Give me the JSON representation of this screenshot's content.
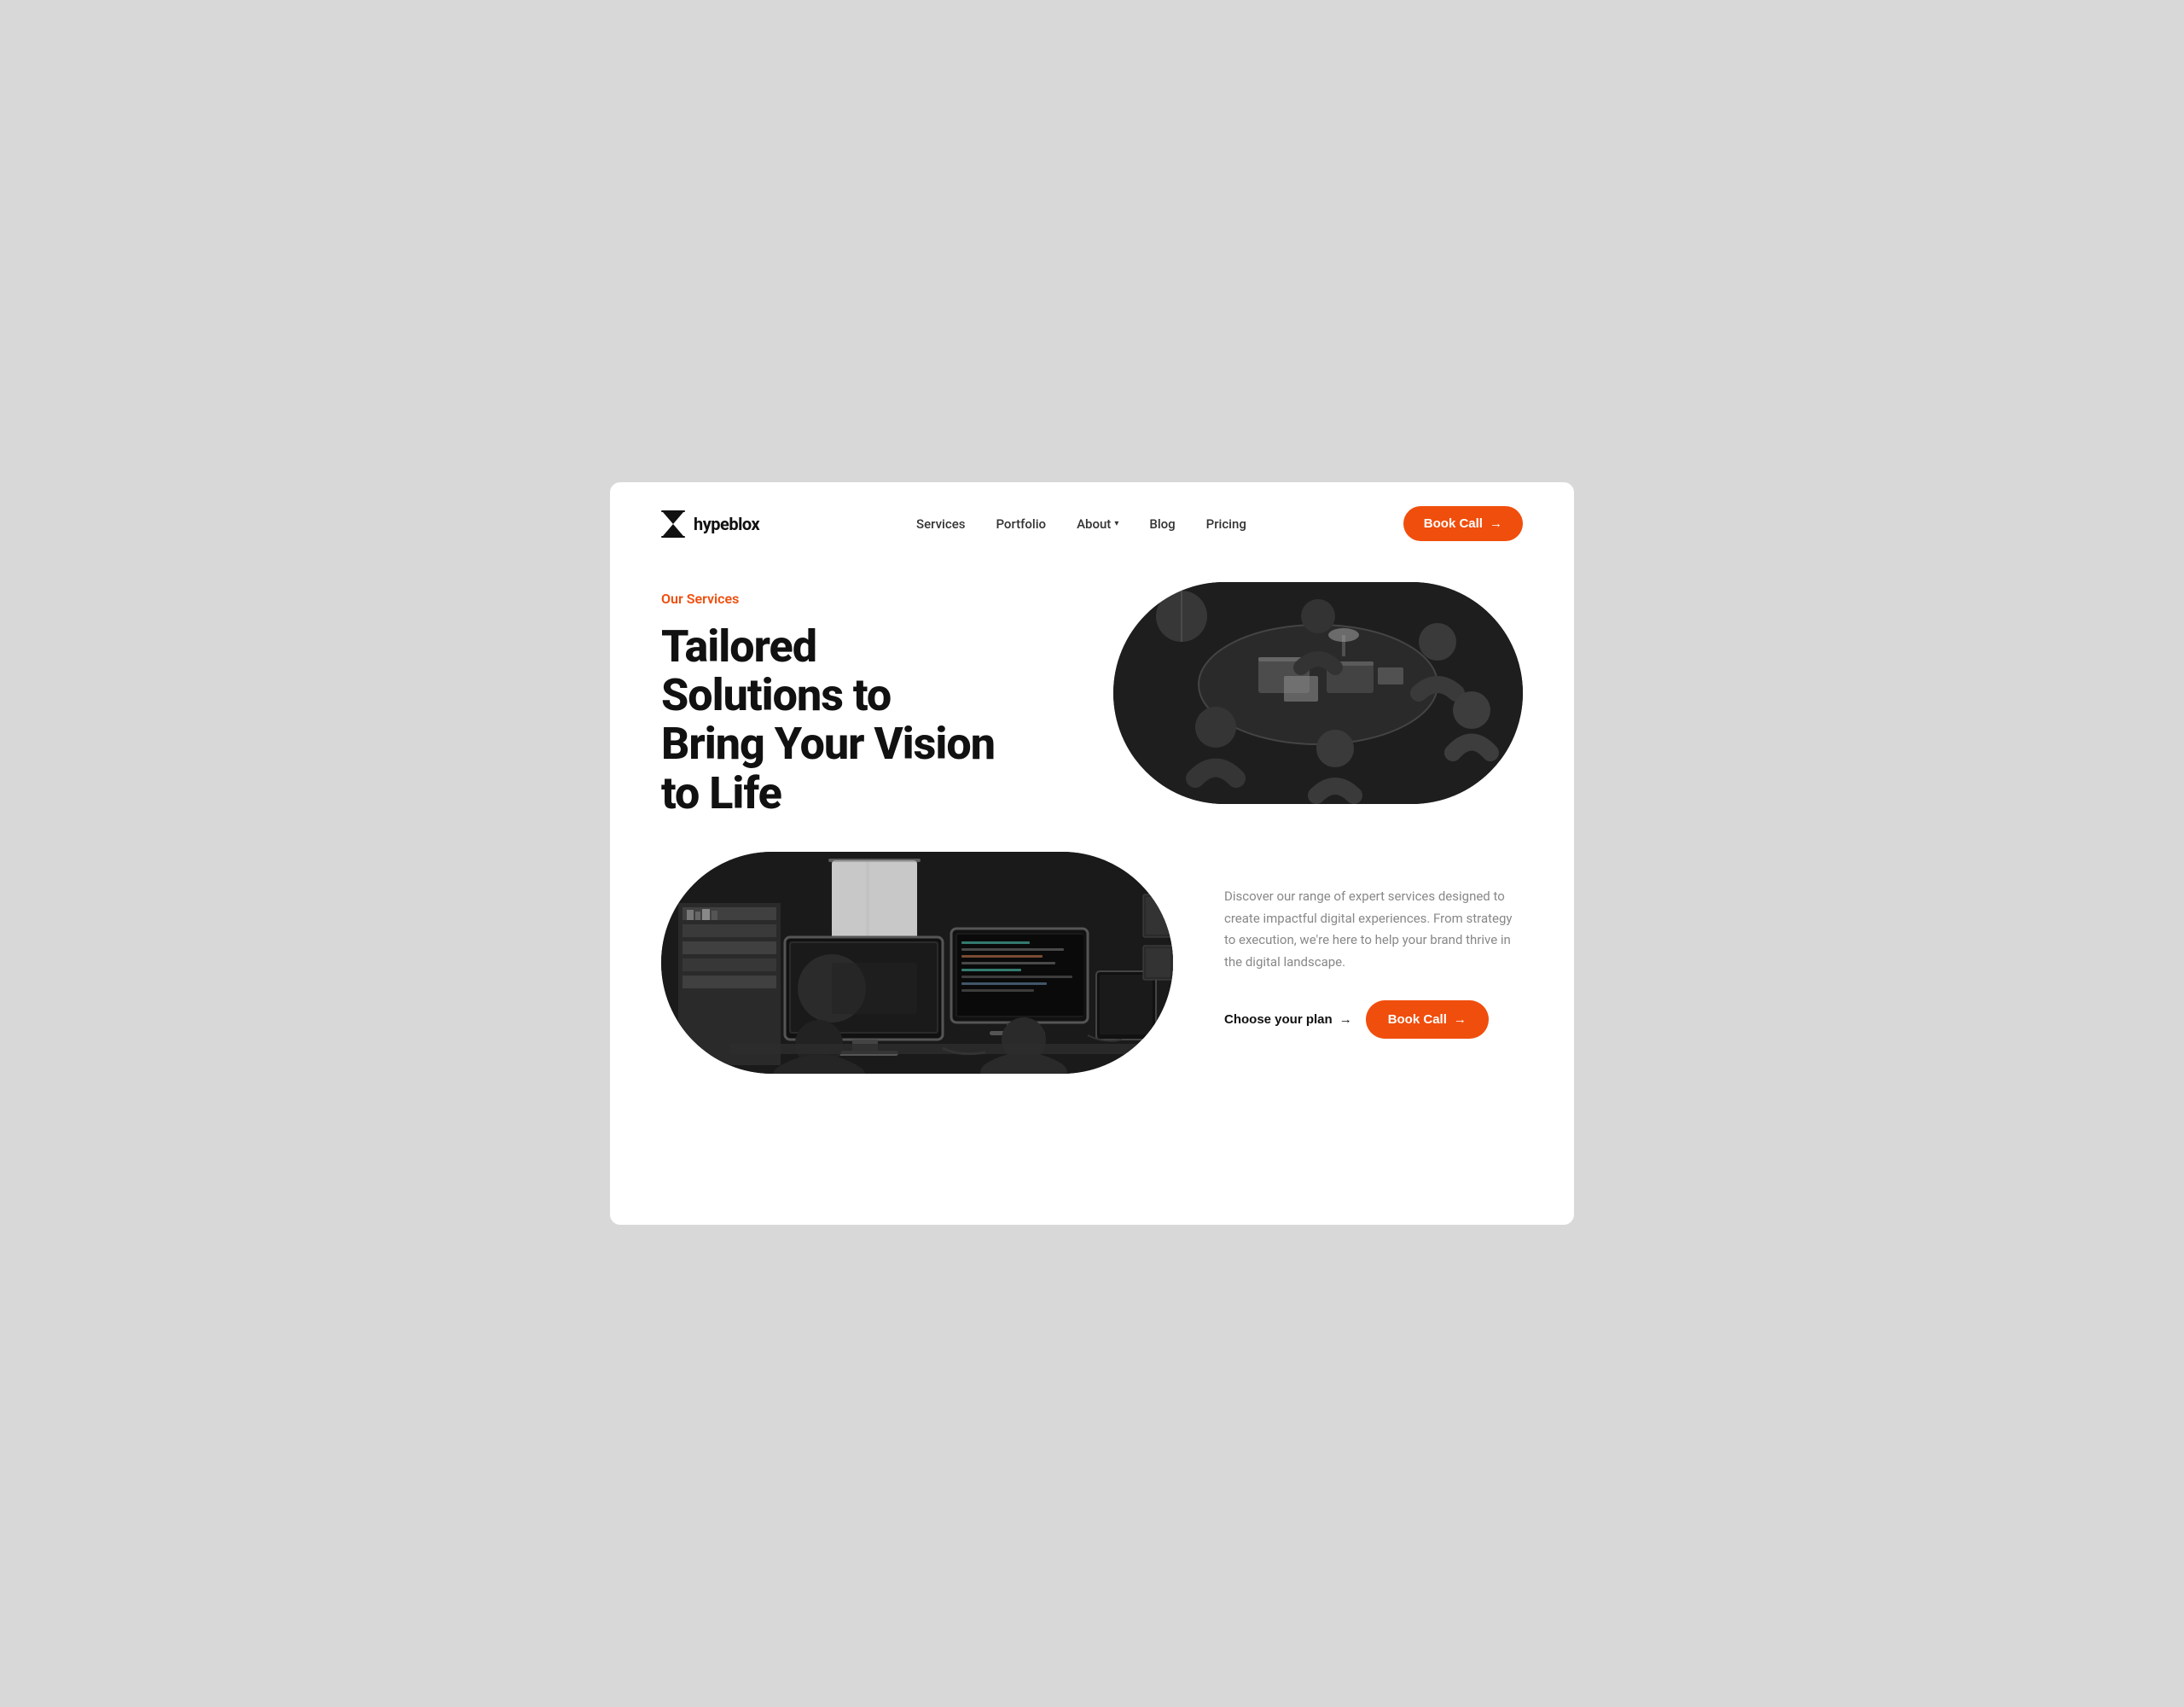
{
  "brand": {
    "name": "hypeblox"
  },
  "nav": {
    "links": [
      {
        "label": "Services",
        "id": "services"
      },
      {
        "label": "Portfolio",
        "id": "portfolio"
      },
      {
        "label": "About",
        "id": "about",
        "hasDropdown": true
      },
      {
        "label": "Blog",
        "id": "blog"
      },
      {
        "label": "Pricing",
        "id": "pricing"
      }
    ],
    "cta": {
      "label": "Book Call",
      "arrow": "→"
    }
  },
  "hero": {
    "services_label": "Our Services",
    "heading_line1": "Tailored",
    "heading_line2": "Solutions to",
    "heading_line3": "Bring Your Vision",
    "heading_line4": "to Life"
  },
  "description": {
    "text": "Discover our range of expert services designed to create impactful digital experiences. From strategy to execution, we're here to help your brand thrive in the digital landscape."
  },
  "cta": {
    "choose_plan": "Choose your plan",
    "arrow": "→",
    "book_call": "Book Call"
  },
  "colors": {
    "accent": "#f04e0d",
    "text_dark": "#111111",
    "text_muted": "#888888",
    "bg_white": "#ffffff",
    "bg_page": "#d8d8d8"
  }
}
